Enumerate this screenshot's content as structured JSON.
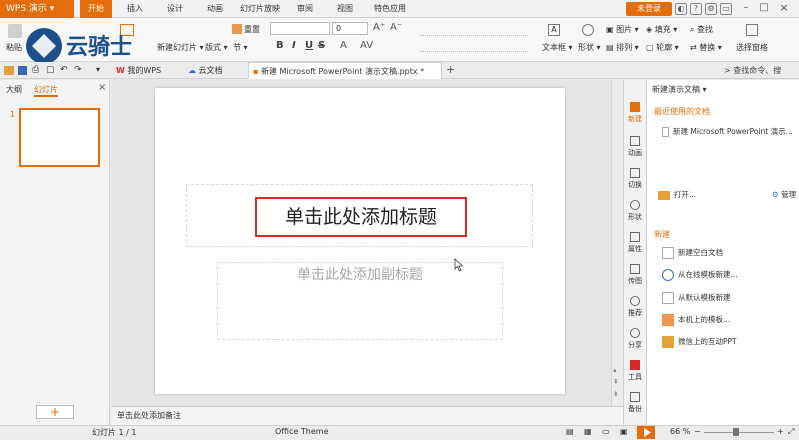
{
  "app": {
    "title": "WPS 演示",
    "login_label": "未登录"
  },
  "menu_tabs": [
    "开始",
    "插入",
    "设计",
    "动画",
    "幻灯片放映",
    "审阅",
    "视图",
    "特色应用"
  ],
  "watermark": {
    "text": "云骑士"
  },
  "ribbon": {
    "paste": "粘贴",
    "new_slide": "新建幻灯片",
    "layout": "版式",
    "section": "节",
    "reset": "重置",
    "font_size": "0",
    "textbox": "文本框",
    "shape": "形状",
    "arrange": "排列",
    "picture": "图片",
    "fill": "填充",
    "outline": "轮廓",
    "find": "查找",
    "replace": "替换",
    "select_pane": "选择窗格",
    "format_bold": "B",
    "format_italic": "I",
    "format_underline": "U",
    "format_strike": "S",
    "search_hint": "查找命令、搜"
  },
  "doc_tabs": [
    {
      "label": "我的WPS"
    },
    {
      "label": "云文档"
    },
    {
      "label": "新建 Microsoft PowerPoint 演示文稿.pptx *"
    }
  ],
  "left_panel": {
    "tab_outline": "大纲",
    "tab_slides": "幻灯片",
    "slide_number": "1",
    "close": "×",
    "add": "+"
  },
  "slide": {
    "title_placeholder": "单击此处添加标题",
    "subtitle_placeholder": "单击此处添加副标题"
  },
  "notes_placeholder": "单击此处添加备注",
  "side_toolbar": [
    "新建",
    "动画",
    "切换",
    "形状",
    "属性",
    "传图",
    "推荐",
    "分享",
    "工具",
    "备份"
  ],
  "right_pane": {
    "header": "新建演示文稿",
    "recent_title": "最近使用的文档",
    "recent_item": "新建 Microsoft PowerPoint 演示...",
    "open": "打开...",
    "manage": "管理",
    "new_title": "新建",
    "new_items": [
      "新建空白文档",
      "从在线模板新建...",
      "从默认模板新建",
      "本机上的模板...",
      "微信上的互动PPT"
    ]
  },
  "status": {
    "slide_info": "幻灯片 1 / 1",
    "theme": "Office Theme",
    "zoom": "66 %"
  },
  "colors": {
    "accent": "#e46c0a",
    "title_highlight": "#d62a2a"
  }
}
